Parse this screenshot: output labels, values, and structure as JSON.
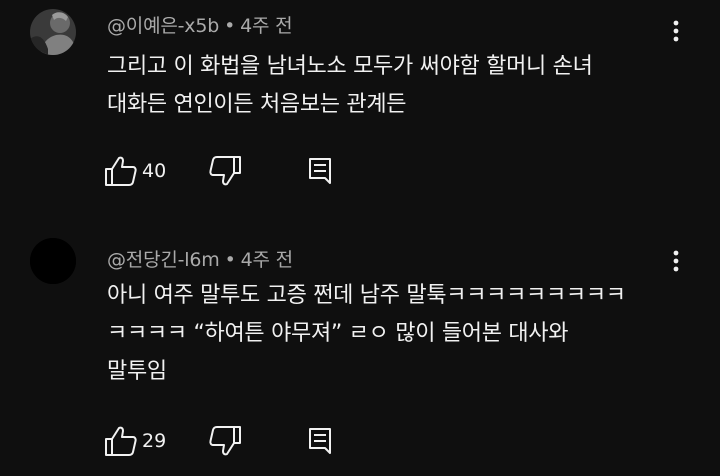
{
  "comments": [
    {
      "author": "@이예은-x5b",
      "separator": "•",
      "time": "4주 전",
      "lines": [
        "그리고 이 화법을 남녀노소 모두가 써야함 할머니 손녀",
        "대화든 연인이든 처음보는 관계든"
      ],
      "likes": "40",
      "avatar_color": "#5b5b5b"
    },
    {
      "author": "@전당긴-l6m",
      "separator": "•",
      "time": "4주 전",
      "lines": [
        "아니 여주 말투도 고증 쩐데 남주 말툭ㅋㅋㅋㅋㅋㅋㅋㅋㅋ",
        "ㅋㅋㅋㅋ “하여튼 야무져” ㄹㅇ 많이 들어본 대사와",
        "말투임"
      ],
      "likes": "29",
      "avatar_color": "#000000"
    }
  ],
  "icons": {
    "like": "thumbs-up-icon",
    "dislike": "thumbs-down-icon",
    "reply": "reply-icon",
    "more": "more-vertical-icon"
  },
  "colors": {
    "background": "#0f0f0f",
    "text": "#f1f1f1",
    "meta": "#aaaaaa"
  }
}
